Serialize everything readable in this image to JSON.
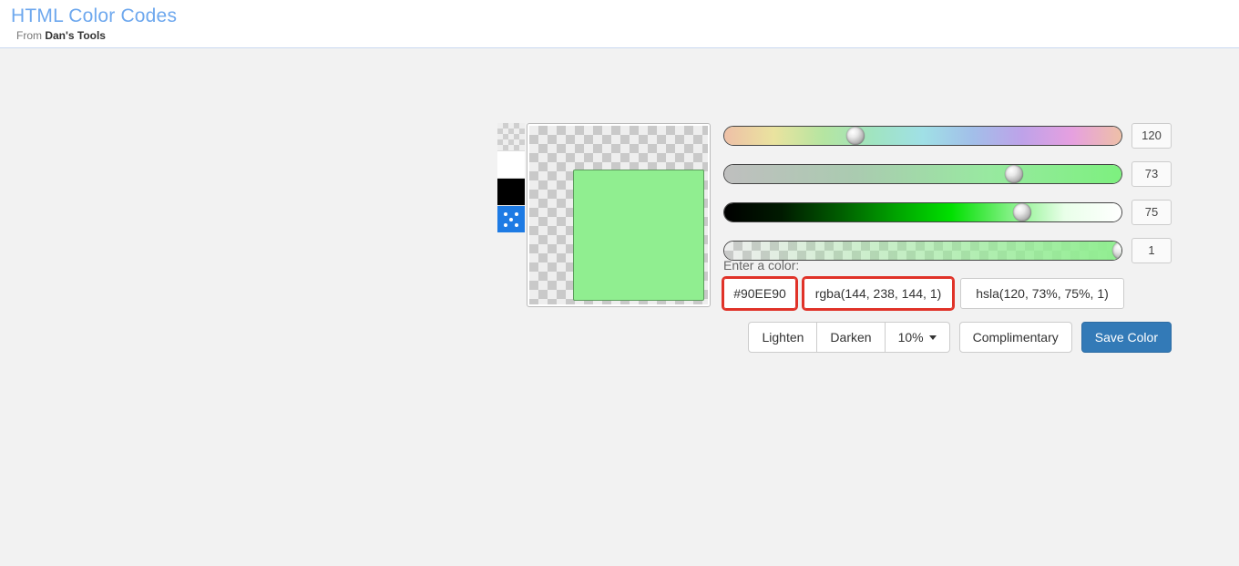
{
  "header": {
    "title": "HTML Color Codes",
    "from": "From ",
    "dans": "Dan's Tools"
  },
  "color": {
    "preview_css": "#90EE90",
    "hue": 120,
    "sat": 73,
    "lum": 75,
    "alpha": 1
  },
  "knobs": {
    "hue_pct": 33,
    "sat_pct": 73,
    "lum_pct": 75,
    "alpha_pct": 100
  },
  "labels": {
    "enter": "Enter a color:"
  },
  "inputs": {
    "hex": "#90EE90",
    "rgba": "rgba(144, 238, 144, 1)",
    "hsla": "hsla(120, 73%, 75%, 1)"
  },
  "buttons": {
    "lighten": "Lighten",
    "darken": "Darken",
    "pct": "10% ",
    "complimentary": "Complimentary",
    "save": "Save Color"
  }
}
